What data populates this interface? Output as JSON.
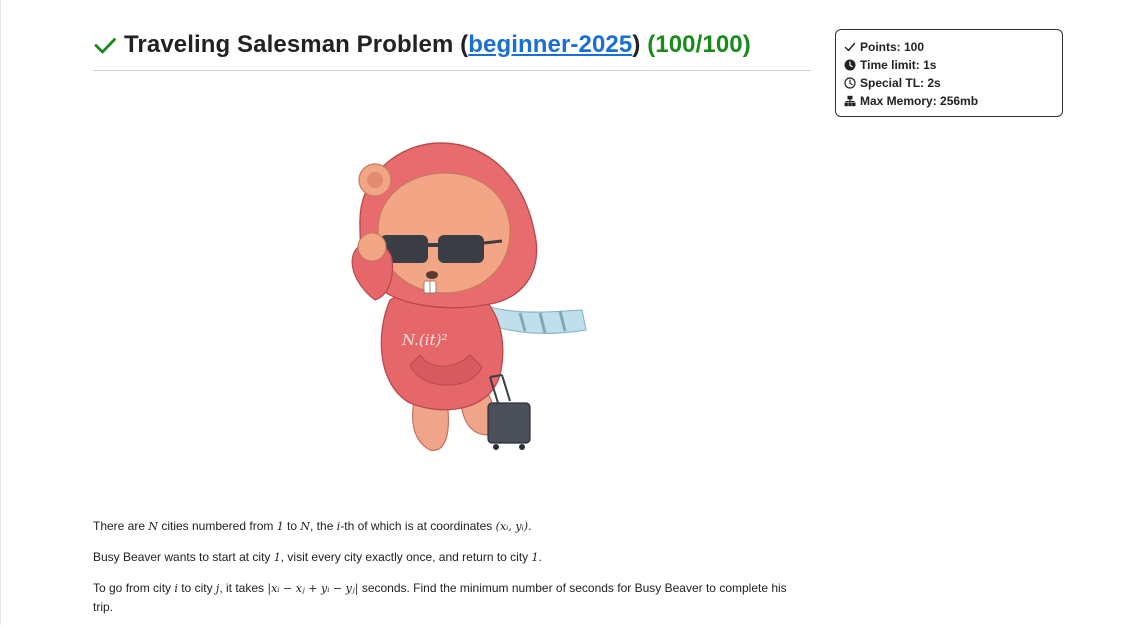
{
  "problem": {
    "title_main": "Traveling Salesman Problem",
    "title_paren_open": " (",
    "contest_link": "beginner-2025",
    "title_paren_close": ")",
    "score": "(100/100)",
    "status_color": "#1a8a1a",
    "link_color": "#1a6fd6",
    "status_icon": "check-icon"
  },
  "info": {
    "points": "Points: 100",
    "time_limit": "Time limit: 1s",
    "special_tl": "Special TL: 2s",
    "max_memory": "Max Memory: 256mb",
    "icons": [
      "check-icon",
      "clock-filled-icon",
      "clock-outline-icon",
      "memory-icon"
    ]
  },
  "illustration": {
    "shirt_text": "N.(it)²"
  },
  "statement": {
    "p1": {
      "a": "There are ",
      "m1": "N",
      "b": " cities numbered from ",
      "m2": "1",
      "c": " to ",
      "m3": "N",
      "d": ", the ",
      "m4": "i",
      "e": "-th of which is at coordinates ",
      "m5": "(xᵢ, yᵢ)",
      "f": "."
    },
    "p2": {
      "a": "Busy Beaver wants to start at city ",
      "m1": "1",
      "b": ", visit every city exactly once, and return to city ",
      "m2": "1",
      "c": "."
    },
    "p3": {
      "a": "To go from city ",
      "m1": "i",
      "b": " to city ",
      "m2": "j",
      "c": ", it takes ",
      "m3": "|xᵢ − xⱼ + yᵢ − yⱼ|",
      "d": " seconds. Find the minimum number of seconds for Busy Beaver to complete his trip."
    }
  }
}
